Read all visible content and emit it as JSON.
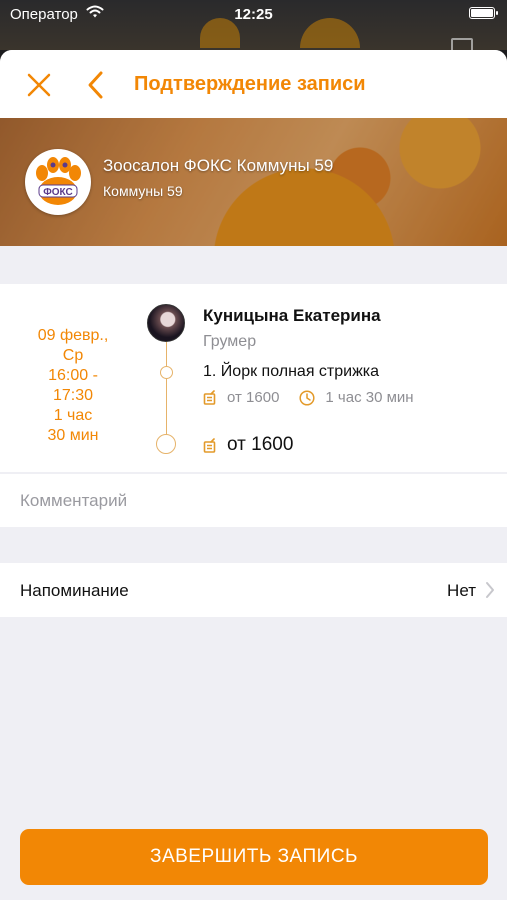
{
  "status_bar": {
    "carrier": "Оператор",
    "time": "12:25",
    "wifi_icon": "wifi-icon",
    "battery_icon": "battery-icon",
    "battery_level": 1.0
  },
  "header": {
    "title": "Подтверждение записи",
    "close_icon": "close-icon",
    "back_icon": "chevron-left-icon"
  },
  "salon": {
    "name": "Зоосалон ФОКС Коммуны 59",
    "address": "Коммуны 59",
    "logo_text": "ФОКС"
  },
  "appointment": {
    "date_lines": [
      "09 февр.,",
      "Ср",
      "16:00 -",
      "17:30",
      "1 час",
      "30 мин"
    ],
    "master": {
      "name": "Куницына Екатерина",
      "role": "Грумер"
    },
    "service": {
      "name": "1. Йорк полная стрижка",
      "price": "от 1600",
      "duration": "1 час 30 мин"
    },
    "total": "от 1600"
  },
  "comment": {
    "placeholder": "Комментарий",
    "value": ""
  },
  "reminder": {
    "label": "Напоминание",
    "value": "Нет"
  },
  "submit": {
    "label": "ЗАВЕРШИТЬ ЗАПИСЬ"
  },
  "colors": {
    "accent": "#f28705",
    "timeline": "#e6b36a",
    "secondary_text": "#8e8e93",
    "background": "#efeff4"
  }
}
